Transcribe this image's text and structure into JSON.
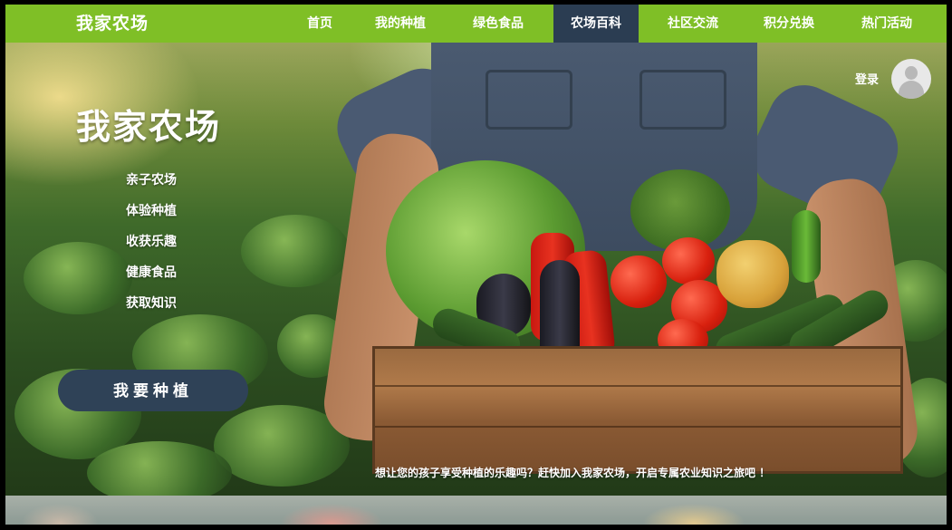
{
  "site": {
    "logo": "我家农场"
  },
  "nav": {
    "items": [
      {
        "label": "首页",
        "active": false
      },
      {
        "label": "我的种植",
        "active": false
      },
      {
        "label": "绿色食品",
        "active": false
      },
      {
        "label": "农场百科",
        "active": true
      },
      {
        "label": "社区交流",
        "active": false
      },
      {
        "label": "积分兑换",
        "active": false
      },
      {
        "label": "热门活动",
        "active": false
      }
    ]
  },
  "user": {
    "login_label": "登录",
    "avatar_icon": "user-avatar-icon"
  },
  "hero": {
    "title": "我家农场",
    "menu": [
      {
        "label": "亲子农场"
      },
      {
        "label": "体验种植"
      },
      {
        "label": "收获乐趣"
      },
      {
        "label": "健康食品"
      },
      {
        "label": "获取知识"
      }
    ],
    "cta_label": "我要种植",
    "slogan": "想让您的孩子享受种植的乐趣吗？赶快加入我家农场，开启专属农业知识之旅吧 ！"
  },
  "colors": {
    "nav_bg": "#7fbf26",
    "nav_active": "#2b3d52",
    "cta_bg": "#2f4257"
  }
}
